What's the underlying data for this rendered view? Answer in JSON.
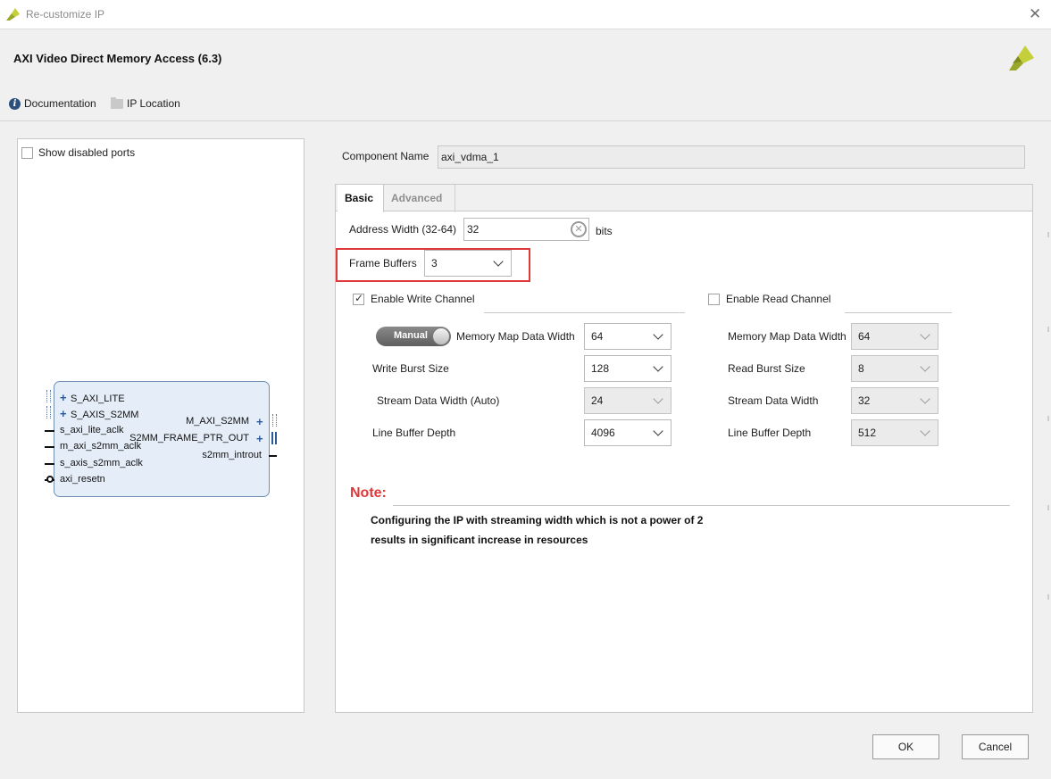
{
  "window": {
    "title": "Re-customize IP",
    "close_icon": "close-icon"
  },
  "header": {
    "ip_title": "AXI Video Direct Memory Access (6.3)",
    "doc_link": "Documentation",
    "ip_location_link": "IP Location"
  },
  "left_panel": {
    "show_disabled_label": "Show disabled ports",
    "show_disabled_checked": false,
    "block": {
      "left_ports": [
        "S_AXI_LITE",
        "S_AXIS_S2MM",
        "s_axi_lite_aclk",
        "m_axi_s2mm_aclk",
        "s_axis_s2mm_aclk",
        "axi_resetn"
      ],
      "right_ports": [
        "M_AXI_S2MM",
        "S2MM_FRAME_PTR_OUT",
        "s2mm_introut"
      ]
    }
  },
  "component": {
    "label": "Component Name",
    "value": "axi_vdma_1"
  },
  "tabs": [
    "Basic",
    "Advanced"
  ],
  "basic": {
    "address_width_label": "Address Width (32-64)",
    "address_width_value": "32",
    "address_width_unit": "bits",
    "frame_buffers_label": "Frame Buffers",
    "frame_buffers_value": "3",
    "write": {
      "enable_label": "Enable Write Channel",
      "enabled": true,
      "toggle_label": "Manual",
      "mm_width_label": "Memory Map Data Width",
      "mm_width_value": "64",
      "burst_label": "Write Burst Size",
      "burst_value": "128",
      "stream_label": "Stream Data Width (Auto)",
      "stream_value": "24",
      "line_buffer_label": "Line Buffer Depth",
      "line_buffer_value": "4096"
    },
    "read": {
      "enable_label": "Enable Read Channel",
      "enabled": false,
      "mm_width_label": "Memory Map Data Width",
      "mm_width_value": "64",
      "burst_label": "Read Burst Size",
      "burst_value": "8",
      "stream_label": "Stream Data Width",
      "stream_value": "32",
      "line_buffer_label": "Line Buffer Depth",
      "line_buffer_value": "512"
    },
    "note": {
      "title": "Note:",
      "line1": "Configuring the IP with streaming width which is not a power of 2",
      "line2": "results in significant increase in resources"
    }
  },
  "buttons": {
    "ok": "OK",
    "cancel": "Cancel"
  },
  "colors": {
    "highlight": "#e0393a",
    "note": "#e0393a",
    "brand": "#b5c236"
  }
}
